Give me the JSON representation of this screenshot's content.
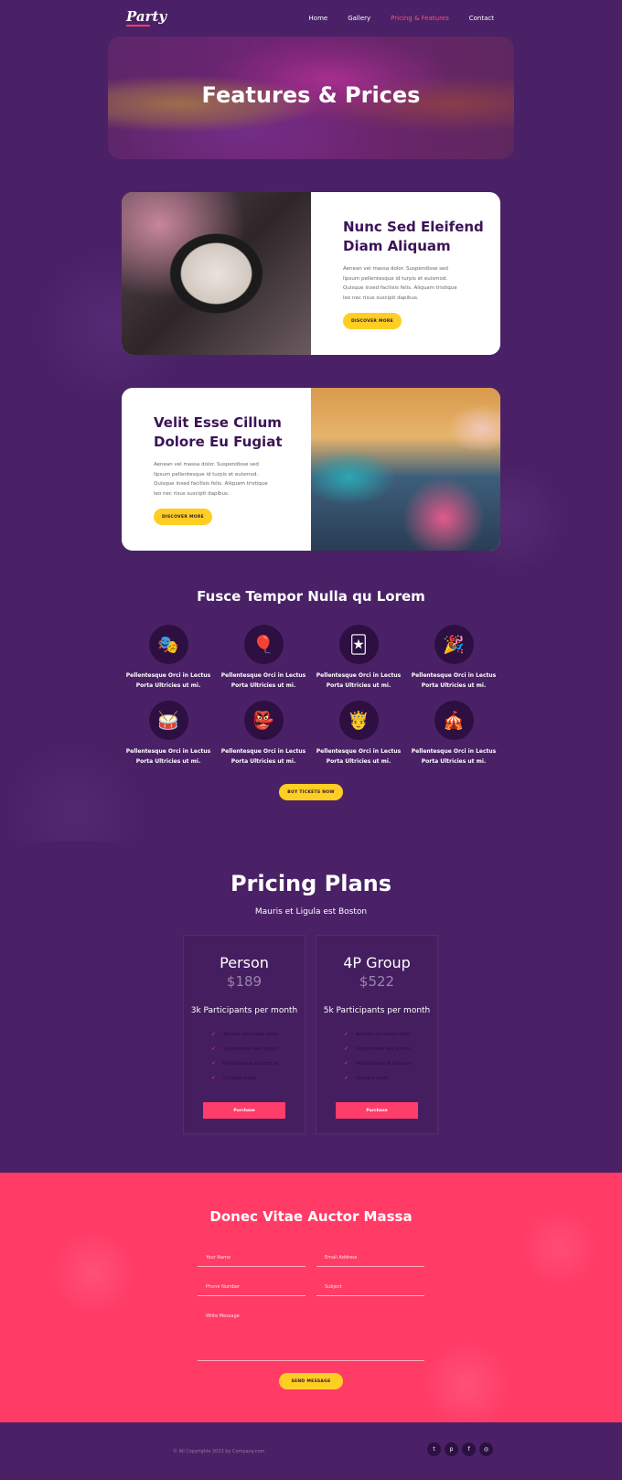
{
  "nav": {
    "logo": "Party",
    "links": [
      "Home",
      "Gallery",
      "Pricing & Features",
      "Contact"
    ],
    "active": "Pricing & Features"
  },
  "hero": {
    "title": "Features & Prices"
  },
  "card1": {
    "title": "Nunc Sed Eleifend Diam Aliquam",
    "body": "Aenean vel massa dolor. Suspendisse sed lipsum pellentesque id turpis et euismod. Quisque insed facilisis felis. Aliquam tristique leo nec risus suscipit dapibus.",
    "button": "DISCOVER MORE"
  },
  "card2": {
    "title": "Velit Esse Cillum Dolore Eu Fugiat",
    "body": "Aenean vel massa dolor. Suspendisse sed lipsum pellentesque id turpis et euismod. Quisque insed facilisis felis. Aliquam tristique leo nec risus suscipit dapibus.",
    "button": "DISCOVER MORE"
  },
  "features": {
    "title": "Fusce Tempor Nulla qu Lorem",
    "items": [
      {
        "icon": "theater-masks-icon",
        "glyph": "🎭",
        "label": "Pellentesque Orci in Lectus Porta Ultricies ut mi."
      },
      {
        "icon": "balloons-icon",
        "glyph": "🎈",
        "label": "Pellentesque Orci in Lectus Porta Ultricies ut mi."
      },
      {
        "icon": "jester-icon",
        "glyph": "🃏",
        "label": "Pellentesque Orci in Lectus Porta Ultricies ut mi."
      },
      {
        "icon": "fireworks-icon",
        "glyph": "🎉",
        "label": "Pellentesque Orci in Lectus Porta Ultricies ut mi."
      },
      {
        "icon": "drum-icon",
        "glyph": "🥁",
        "label": "Pellentesque Orci in Lectus Porta Ultricies ut mi."
      },
      {
        "icon": "carnival-mask-icon",
        "glyph": "👺",
        "label": "Pellentesque Orci in Lectus Porta Ultricies ut mi."
      },
      {
        "icon": "king-icon",
        "glyph": "🤴",
        "label": "Pellentesque Orci in Lectus Porta Ultricies ut mi."
      },
      {
        "icon": "circus-tent-icon",
        "glyph": "🎪",
        "label": "Pellentesque Orci in Lectus Porta Ultricies ut mi."
      }
    ],
    "button": "BUY TICKETS NOW"
  },
  "pricing": {
    "title": "Pricing Plans",
    "subtitle": "Mauris et Ligula est Boston",
    "plans": [
      {
        "name": "Person",
        "price": "$189",
        "per": "3k Participants per month",
        "features": [
          "Aenean vel massa dolor",
          "Suspendisse sed lipsum",
          "Pellentesque id turpis et",
          "Quisque insed"
        ],
        "button": "Purchase"
      },
      {
        "name": "4P Group",
        "price": "$522",
        "per": "5k Participants per month",
        "features": [
          "Aenean vel massa dolor",
          "Suspendisse sed lipsum",
          "Pellentesque id turpis et",
          "Quisque insed"
        ],
        "button": "Purchase"
      }
    ]
  },
  "contact": {
    "title": "Donec Vitae Auctor Massa",
    "name": "Your Name",
    "email": "Email Address",
    "phone": "Phone Number",
    "subject": "Subject",
    "message": "Write Message",
    "button": "SEND MESSAGE"
  },
  "footer": {
    "copyright": "© All Copyrights 2023 by Company.com",
    "social": [
      {
        "icon": "twitter-icon",
        "glyph": "t"
      },
      {
        "icon": "pinterest-icon",
        "glyph": "p"
      },
      {
        "icon": "facebook-icon",
        "glyph": "f"
      },
      {
        "icon": "instagram-icon",
        "glyph": "◎"
      }
    ]
  },
  "colors": {
    "background": "#4a2166",
    "accent_pink": "#ff3b66",
    "accent_yellow": "#ffce22",
    "dark_purple": "#2d0f42"
  }
}
